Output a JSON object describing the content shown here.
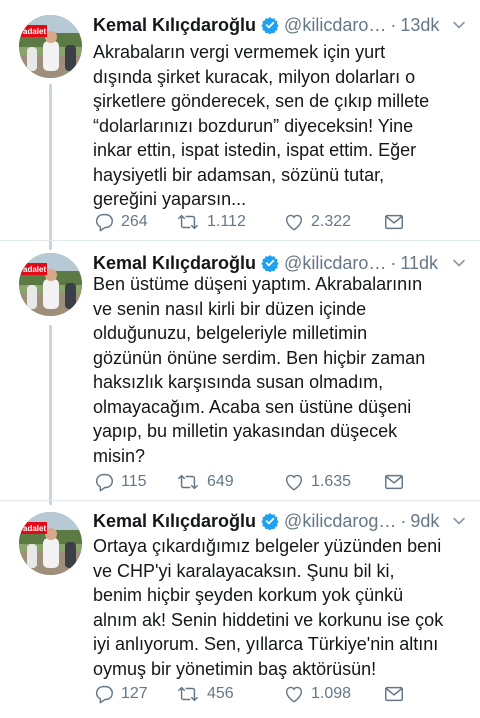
{
  "tweets": [
    {
      "name": "Kemal Kılıçdaroğlu",
      "handle": "@kilicdaro…",
      "time": "13dk",
      "avatar_text": "adalet",
      "lines": [
        "Akrabaların vergi vermemek için yurt",
        "dışında şirket kuracak, milyon dolarları o",
        "şirketlere gönderecek, sen de çıkıp millete",
        "“dolarlarınızı bozdurun” diyeceksin! Yine",
        "inkar ettin, ispat istedin, ispat ettim. Eğer",
        "haysiyetli bir adamsan, sözünü tutar,",
        "gereğini yaparsın..."
      ],
      "replies": "264",
      "retweets": "1.112",
      "likes": "2.322"
    },
    {
      "name": "Kemal Kılıçdaroğlu",
      "handle": "@kilicdaro…",
      "time": "11dk",
      "avatar_text": "adalet",
      "lines": [
        "Ben üstüme düşeni yaptım. Akrabalarının",
        "ve senin nasıl kirli bir düzen içinde",
        "olduğunuzu, belgeleriyle milletimin",
        "gözünün önüne serdim. Ben hiçbir zaman",
        "haksızlık karşısında susan olmadım,",
        "olmayacağım. Acaba sen üstüne düşeni",
        "yapıp, bu milletin yakasından düşecek",
        "misin?"
      ],
      "replies": "115",
      "retweets": "649",
      "likes": "1.635"
    },
    {
      "name": "Kemal Kılıçdaroğlu",
      "handle": "@kilicdarog…",
      "time": "9dk",
      "avatar_text": "adalet",
      "lines": [
        "Ortaya çıkardığımız belgeler yüzünden beni",
        "ve CHP'yi karalayacaksın. Şunu bil ki,",
        "benim hiçbir şeyden korkum yok çünkü",
        "alnım ak! Senin hiddetini ve korkunu ise çok",
        "iyi anlıyorum. Sen, yıllarca Türkiye'nin altını",
        "oymuş bir yönetimin baş aktörüsün!"
      ],
      "replies": "127",
      "retweets": "456",
      "likes": "1.098"
    }
  ],
  "colors": {
    "text": "#14171a",
    "secondary": "#657786",
    "verified": "#1da1f2",
    "divider": "#e1e8ed",
    "thread_line": "#c9d5dd",
    "avatar_red": "#e30a17"
  },
  "icons": [
    "verified-badge-icon",
    "chevron-down-icon",
    "reply-icon",
    "retweet-icon",
    "like-icon",
    "direct-message-icon"
  ]
}
